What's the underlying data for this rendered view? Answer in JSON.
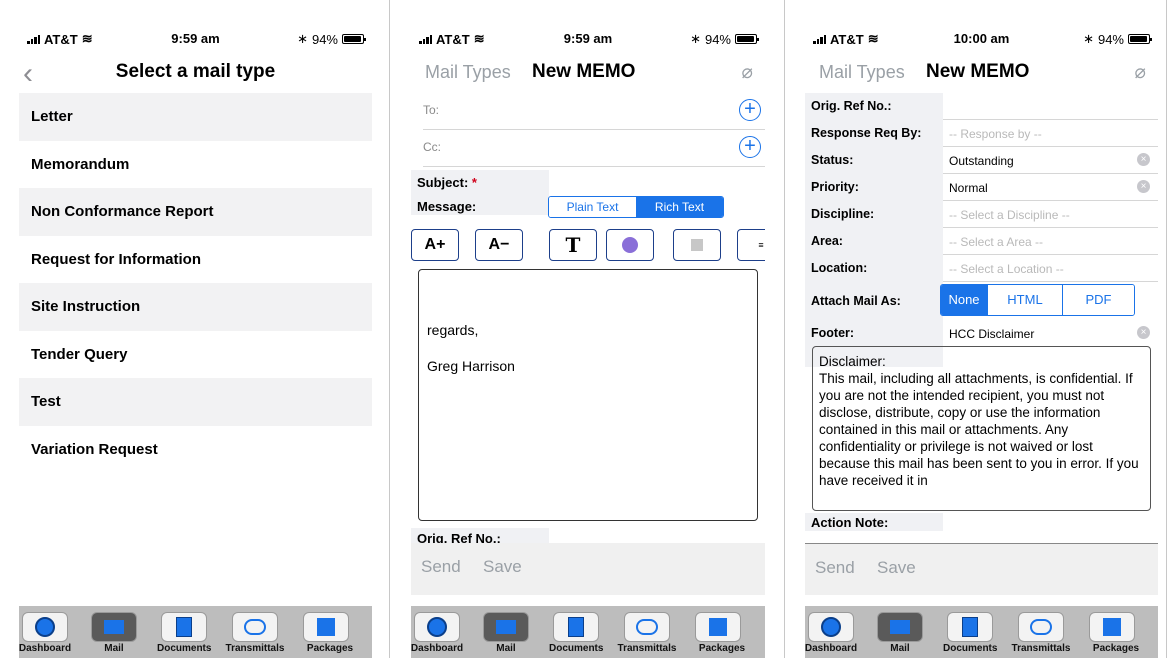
{
  "status": {
    "carrier": "AT&T",
    "battery": "94%",
    "times": [
      "9:59 am",
      "9:59 am",
      "10:00 am"
    ]
  },
  "screen1": {
    "title": "Select a mail type",
    "items": [
      "Letter",
      "Memorandum",
      "Non Conformance Report",
      "Request for Information",
      "Site Instruction",
      "Tender Query",
      "Test",
      "Variation Request"
    ]
  },
  "memo": {
    "back_label": "Mail Types",
    "title": "New MEMO",
    "to_label": "To:",
    "cc_label": "Cc:",
    "subject_label": "Subject:",
    "required_mark": "*",
    "message_label": "Message:",
    "plain_text": "Plain Text",
    "rich_text": "Rich Text",
    "signoff": "regards,",
    "signature": "Greg Harrison",
    "orig_ref_label": "Orig. Ref No.:",
    "send_label": "Send",
    "save_label": "Save"
  },
  "form": {
    "orig_ref_label": "Orig. Ref No.:",
    "response_label": "Response Req By:",
    "response_placeholder": "-- Response by --",
    "status_label": "Status:",
    "status_value": "Outstanding",
    "priority_label": "Priority:",
    "priority_value": "Normal",
    "discipline_label": "Discipline:",
    "discipline_placeholder": "-- Select a Discipline --",
    "area_label": "Area:",
    "area_placeholder": "-- Select a Area --",
    "location_label": "Location:",
    "location_placeholder": "-- Select a Location --",
    "attach_label": "Attach Mail As:",
    "attach_options": [
      "None",
      "HTML",
      "PDF"
    ],
    "footer_label": "Footer:",
    "footer_value": "HCC Disclaimer",
    "disclaimer_title": "Disclaimer:",
    "disclaimer_text": "This mail, including all attachments, is confidential. If you are not the intended recipient, you must not disclose, distribute, copy or use the information contained in this mail or attachments. Any confidentiality or privilege is not waived or lost because this mail has been sent to you in error. If you have received it in",
    "action_note_label": "Action Note:"
  },
  "tabbar": {
    "tabs": [
      "Dashboard",
      "Mail",
      "Documents",
      "Transmittals",
      "Packages"
    ]
  },
  "colors": {
    "accent": "#1a73e8",
    "tabbar": "#bdbdbd",
    "active_tab": "#5a5a5a"
  }
}
